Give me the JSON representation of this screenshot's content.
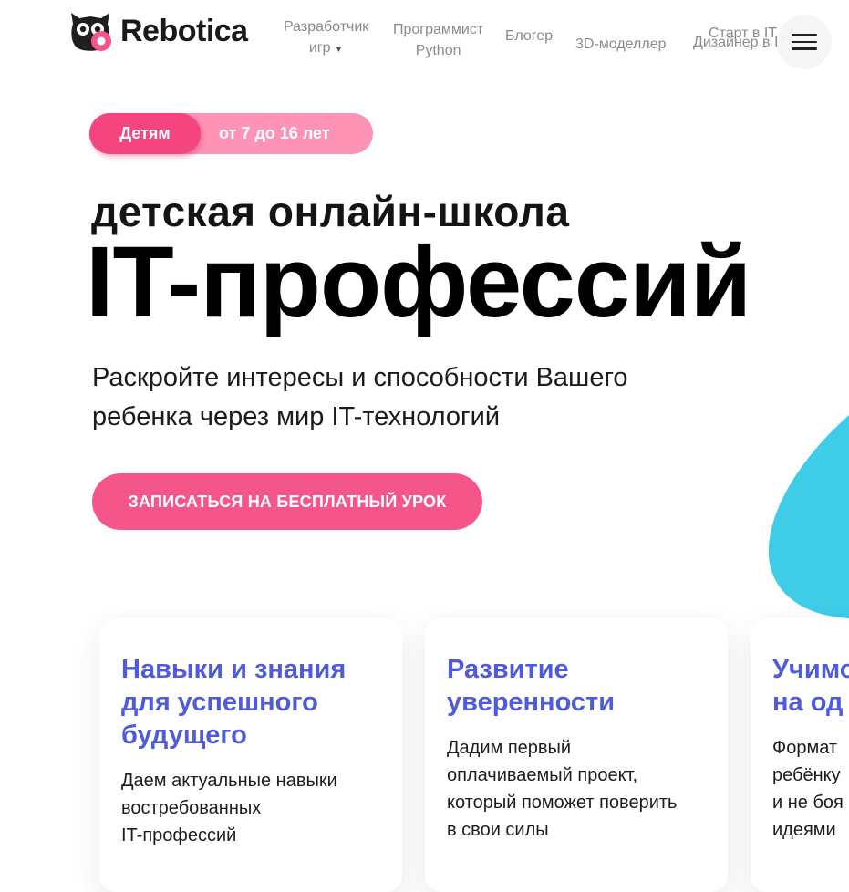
{
  "header": {
    "logo_text": "Rebotica",
    "nav": [
      {
        "line1": "Разработчик",
        "line2": "игр",
        "has_caret": true
      },
      {
        "line1": "Программист",
        "line2": "Python"
      },
      {
        "line1": "Блогер"
      },
      {
        "line1": "3D-моделлер"
      },
      {
        "line1": "Старт в IT"
      },
      {
        "line1": "Дизайнер в IT"
      }
    ],
    "menu_icon": "hamburger-icon"
  },
  "hero": {
    "badge_label": "Детям",
    "badge_age": "от 7 до 16 лет",
    "subtitle": "детская онлайн-школа",
    "title": "IT-профессий",
    "lead_line1": "Раскройте интересы и способности Вашего",
    "lead_line2": "ребенка через мир IT-технологий",
    "cta_label": "ЗАПИСАТЬСЯ НА БЕСПЛАТНЫЙ УРОК"
  },
  "cards": [
    {
      "title_lines": [
        "Навыки и знания",
        "для успешного",
        "будущего"
      ],
      "text_lines": [
        "Даем актуальные навыки",
        "востребованных",
        "IT-профессий"
      ]
    },
    {
      "title_lines": [
        "Развитие",
        "уверенности"
      ],
      "text_lines": [
        "Дадим первый",
        "оплачиваемый проект,",
        "который поможет поверить",
        "в свои силы"
      ]
    },
    {
      "title_lines": [
        "Учимо",
        "на од"
      ],
      "text_lines": [
        "Формат",
        "ребёнку",
        "и не боя",
        "идеями"
      ]
    }
  ],
  "colors": {
    "accent_pink": "#f5568a",
    "pill_light": "#ff93b6",
    "card_title_blue": "#4e5bdc",
    "blob_cyan": "#3ecce6"
  }
}
